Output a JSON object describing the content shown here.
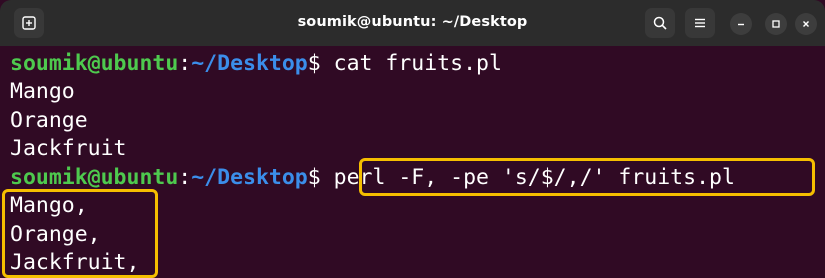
{
  "window": {
    "title": "soumik@ubuntu: ~/Desktop",
    "buttons": {
      "new_tab_icon": "new-tab-icon",
      "search_icon": "search-icon",
      "menu_icon": "hamburger-menu-icon",
      "minimize_icon": "minimize-icon",
      "maximize_icon": "maximize-icon",
      "close_icon": "close-icon"
    }
  },
  "terminal": {
    "prompt1": {
      "user": "soumik@ubuntu",
      "sep": ":",
      "path": "~/Desktop",
      "symbol": "$",
      "command": " cat fruits.pl"
    },
    "output1": [
      "Mango",
      "Orange",
      "Jackfruit"
    ],
    "prompt2": {
      "user": "soumik@ubuntu",
      "sep": ":",
      "path": "~/Desktop",
      "symbol": "$",
      "command": " perl -F, -pe 's/$/,/' fruits.pl"
    },
    "output2": [
      "Mango,",
      "Orange,",
      "Jackfruit,"
    ]
  },
  "colors": {
    "background": "#300a24",
    "titlebar": "#2c2c2c",
    "user": "#4ec94e",
    "path": "#3b8eea",
    "highlight": "#f5be00"
  }
}
